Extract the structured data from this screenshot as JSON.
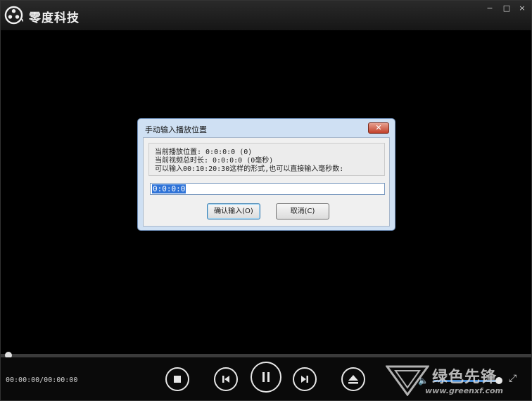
{
  "app": {
    "title": "零度科技",
    "logo_icon": "film-reel-icon"
  },
  "window_buttons": {
    "minimize": "−",
    "maximize": "□",
    "close": "×"
  },
  "dialog": {
    "title": "手动输入播放位置",
    "close_label": "✕",
    "lines": [
      "当前播放位置: 0:0:0:0 (0)",
      "当前视频总时长: 0:0:0:0 (0毫秒)",
      "可以输入00:10:20:30这样的形式,也可以直接输入毫秒数:"
    ],
    "input_value": "0:0:0:0",
    "ok_label": "确认输入(O)",
    "cancel_label": "取消(C)"
  },
  "player": {
    "time_display": "00:00:00/00:00:00",
    "progress": 0.0,
    "volume": 0.98,
    "buttons": [
      "stop-icon",
      "previous-icon",
      "pause-icon",
      "next-icon",
      "eject-icon"
    ]
  },
  "watermark": {
    "text": "绿色先锋",
    "url": "www.greenxf.com"
  },
  "colors": {
    "background": "#000000",
    "dialog_bg": "#cfe0f3",
    "selection": "#3074d8",
    "volume": "#4a8fd8"
  }
}
